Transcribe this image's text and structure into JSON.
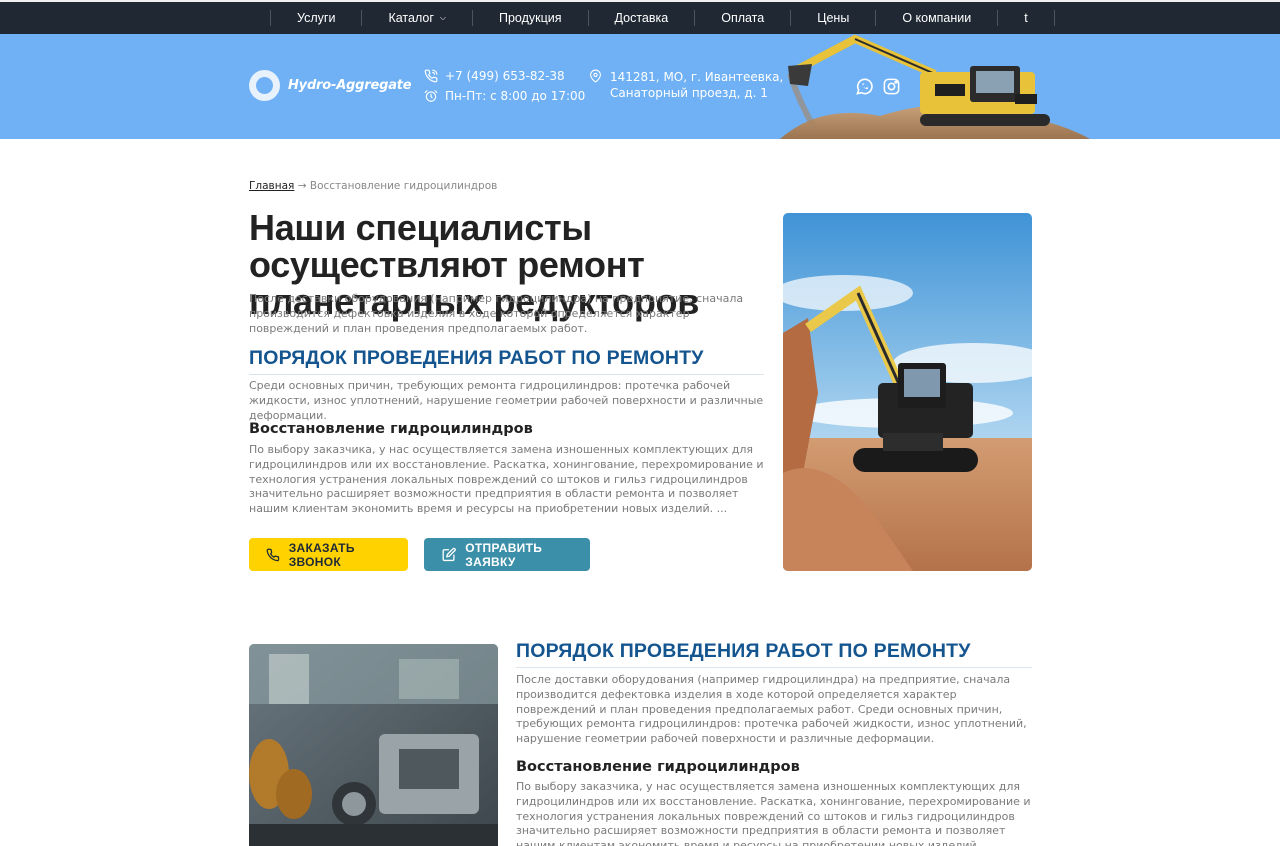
{
  "nav": {
    "items": [
      {
        "label": "Услуги"
      },
      {
        "label": "Каталог",
        "has_dropdown": true
      },
      {
        "label": "Продукция"
      },
      {
        "label": "Доставка"
      },
      {
        "label": "Оплата"
      },
      {
        "label": "Цены"
      },
      {
        "label": "О компании"
      },
      {
        "label": "t"
      }
    ]
  },
  "header": {
    "logo_text": "Hydro-Aggregate",
    "phone": "+7 (499) 653-82-38",
    "hours": "Пн-Пт: с 8:00 до 17:00",
    "address_line1": "141281, МО, г. Ивантеевка,",
    "address_line2": "Санаторный проезд, д. 1",
    "socials": [
      "whatsapp-icon",
      "instagram-icon"
    ]
  },
  "breadcrumb": {
    "home": "Главная",
    "separator": "→",
    "current": "Восстановление гидроцилиндров"
  },
  "main": {
    "title": "Наши специалисты осуществляют ремонт планетарных редукторов",
    "intro": "После доставки оборудования (например гидроцилиндра) на предприятие, сначала производится дефектовка изделия в ходе которой определяется характер повреждений и план проведения предполагаемых работ.",
    "section_title": "ПОРЯДОК ПРОВЕДЕНИЯ РАБОТ ПО РЕМОНТУ",
    "section_text": "Среди основных причин, требующих ремонта гидроцилиндров: протечка рабочей жидкости, износ уплотнений, нарушение геометрии рабочей поверхности и различные деформации.",
    "sub_title": "Восстановление гидроцилиндров",
    "sub_text": "По выбору заказчика, у нас осуществляется замена изношенных комплектующих для гидроцилиндров или их восстановление. Раскатка, хонингование, перехромирование и технология устранения локальных повреждений со штоков и гильз гидроцилиндров значительно расширяет возможности предприятия в области ремонта и позволяет нашим клиентам экономить время и ресурсы на приобретении новых изделий. ...",
    "btn_call": "ЗАКАЗАТЬ ЗВОНОК",
    "btn_send": "ОТПРАВИТЬ ЗАЯВКУ"
  },
  "second": {
    "section_title": "ПОРЯДОК ПРОВЕДЕНИЯ РАБОТ ПО РЕМОНТУ",
    "text": "После доставки оборудования (например гидроцилиндра) на предприятие, сначала производится дефектовка изделия в ходе которой определяется характер повреждений и план проведения предполагаемых работ. Среди основных причин, требующих ремонта гидроцилиндров: протечка рабочей жидкости, износ уплотнений, нарушение геометрии рабочей поверхности и различные деформации.",
    "sub_title": "Восстановление гидроцилиндров",
    "sub_text": "По выбору заказчика, у нас осуществляется замена изношенных комплектующих для гидроцилиндров или их восстановление. Раскатка, хонингование, перехромирование и технология устранения локальных повреждений со штоков и гильз гидроцилиндров значительно расширяет возможности предприятия в области ремонта и позволяет нашим клиентам экономить время и ресурсы на приобретении новых изделий."
  },
  "colors": {
    "nav_bg": "#1f2833",
    "header_bg": "#6fb1f4",
    "heading_blue": "#14558f",
    "btn_yellow": "#ffd200",
    "btn_teal": "#3c8fa8"
  }
}
